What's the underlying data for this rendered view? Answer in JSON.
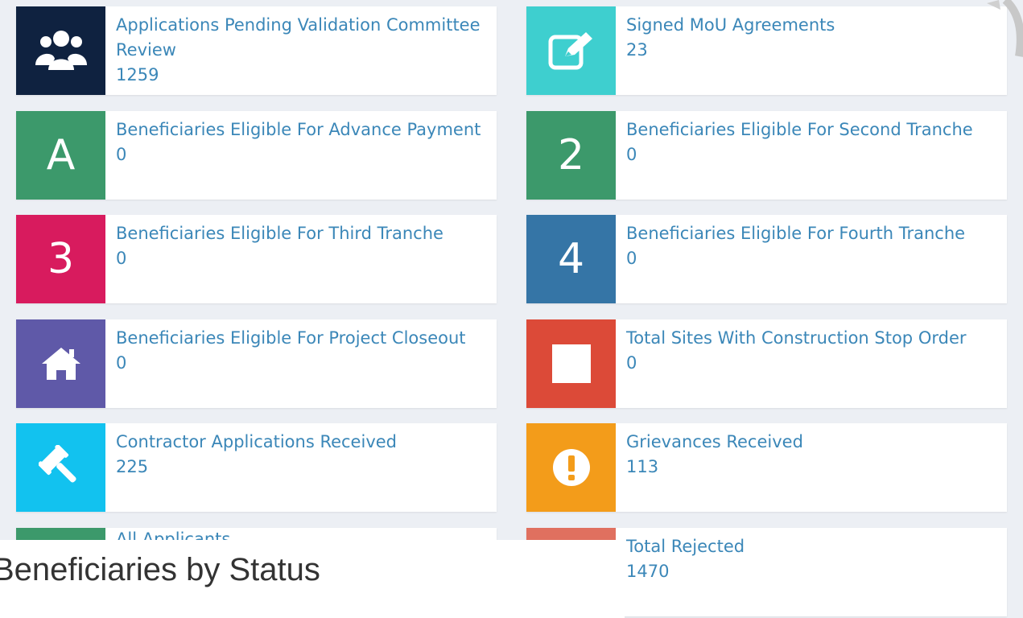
{
  "colors": {
    "navy": "#0f2240",
    "teal": "#3ecfcf",
    "green": "#3c996b",
    "magenta": "#d81b5e",
    "steel_blue": "#3575a6",
    "purple": "#5f59a8",
    "red": "#dc4a38",
    "cyan": "#12c2ef",
    "orange": "#f39c1a",
    "salmon": "#e0705f",
    "link_text": "#3b87b8"
  },
  "cards": [
    {
      "label": "Applications Pending Validation Committee Review",
      "count": "1259",
      "icon": "users-icon"
    },
    {
      "label": "Signed MoU Agreements",
      "count": "23",
      "icon": "edit-icon"
    },
    {
      "label": "Beneficiaries Eligible For Advance Payment",
      "count": "0",
      "icon_text": "A"
    },
    {
      "label": "Beneficiaries Eligible For Second Tranche",
      "count": "0",
      "icon_text": "2"
    },
    {
      "label": "Beneficiaries Eligible For Third Tranche",
      "count": "0",
      "icon_text": "3"
    },
    {
      "label": "Beneficiaries Eligible For Fourth Tranche",
      "count": "0",
      "icon_text": "4"
    },
    {
      "label": "Beneficiaries Eligible For Project Closeout",
      "count": "0",
      "icon": "home-icon"
    },
    {
      "label": "Total Sites With Construction Stop Order",
      "count": "0",
      "icon": "stop-icon"
    },
    {
      "label": "Contractor Applications Received",
      "count": "225",
      "icon": "gavel-icon"
    },
    {
      "label": "Grievances Received",
      "count": "113",
      "icon": "exclamation-icon"
    },
    {
      "label": "All Applicants",
      "count": ""
    },
    {
      "label": "Total Rejected",
      "count": "1470"
    }
  ],
  "overlay": {
    "title": "Beneficiaries by Status"
  }
}
